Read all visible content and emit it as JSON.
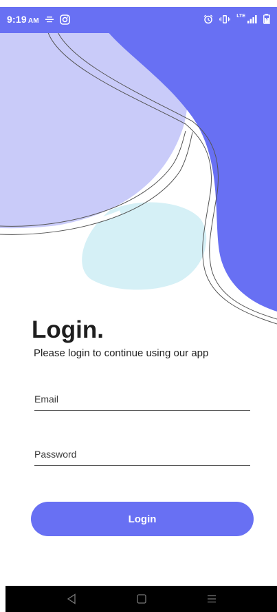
{
  "status_bar": {
    "time": "9:19",
    "ampm": "AM",
    "network": "LTE",
    "left_icons": [
      "notification-icon",
      "instagram-icon"
    ],
    "right_icons": [
      "alarm-icon",
      "vibrate-icon",
      "signal-icon",
      "battery-icon"
    ]
  },
  "colors": {
    "accent": "#6870f3",
    "light_lavender": "#c9cbf9",
    "light_blue": "#d5f0f6",
    "heading": "#1e1e1e",
    "nav_bar": "#000000"
  },
  "login": {
    "heading": "Login.",
    "subtitle": "Please login to continue using our app",
    "email_placeholder": "Email",
    "password_placeholder": "Password",
    "button_label": "Login"
  },
  "nav_bar": {
    "icons": [
      "back-icon",
      "home-icon",
      "menu-icon"
    ]
  }
}
